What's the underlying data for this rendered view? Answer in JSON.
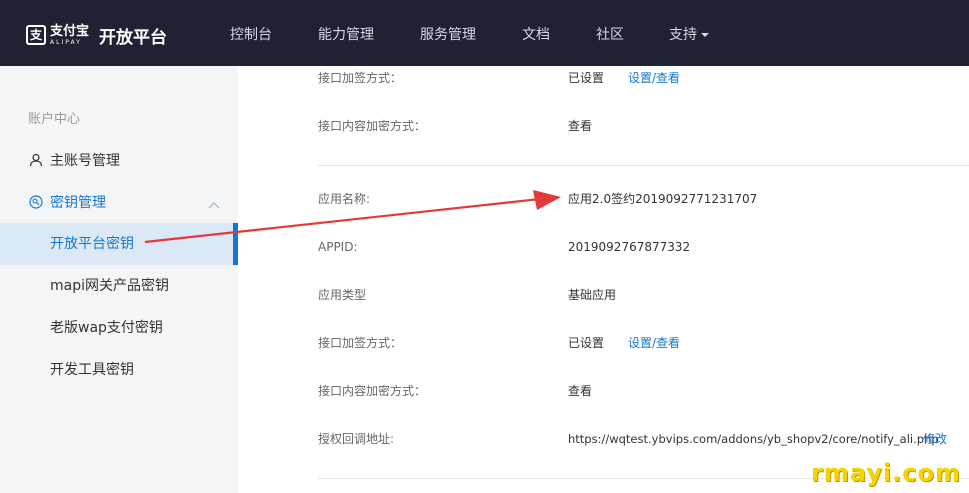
{
  "brand": {
    "logo_glyph": "支",
    "logo_cn": "支付宝",
    "logo_en": "ALIPAY",
    "title": "开放平台"
  },
  "nav": {
    "items": [
      "控制台",
      "能力管理",
      "服务管理",
      "文档",
      "社区",
      "支持"
    ]
  },
  "sidebar": {
    "header": "账户中心",
    "main_account": "主账号管理",
    "key_mgmt": "密钥管理",
    "sub_items": [
      "开放平台密钥",
      "mapi网关产品密钥",
      "老版wap支付密钥",
      "开发工具密钥"
    ],
    "active_index": 0
  },
  "content": {
    "top_section": {
      "sign_method_label": "接口加签方式：",
      "sign_method_value": "已设置",
      "sign_method_action": "设置/查看",
      "encrypt_label": "接口内容加密方式：",
      "encrypt_action": "查看"
    },
    "app_section": {
      "app_name_label": "应用名称:",
      "app_name_value": "应用2.0签约2019092771231707",
      "appid_label": "APPID:",
      "appid_value": "2019092767877332",
      "app_type_label": "应用类型",
      "app_type_value": "基础应用",
      "sign_method_label": "接口加签方式：",
      "sign_method_value": "已设置",
      "sign_method_action": "设置/查看",
      "encrypt_label": "接口内容加密方式：",
      "encrypt_action": "查看",
      "callback_label": "授权回调地址:",
      "callback_value": "https://wqtest.ybvips.com/addons/yb_shopv2/core/notify_ali.php",
      "callback_action": "修改"
    }
  },
  "watermark": "rmayi.com",
  "colors": {
    "topbar_bg": "#1f2233",
    "sidebar_bg": "#f4f5f7",
    "accent": "#1677d2",
    "active_bg": "#dbe8f5",
    "annotation_arrow": "#e5383b",
    "watermark": "#f4d400"
  }
}
